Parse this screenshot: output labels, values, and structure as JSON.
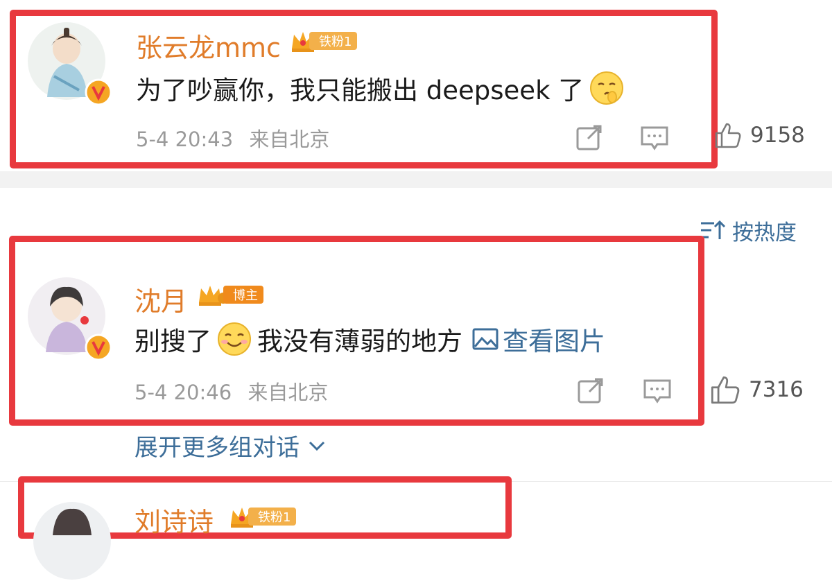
{
  "comments": [
    {
      "username": "张云龙mmc",
      "badge": "铁粉1",
      "text_before": "为了吵赢你，我只能搬出 deepseek 了",
      "text_after": "",
      "emoji": "shushing-face-emoji",
      "time": "5-4 20:43",
      "location": "来自北京",
      "likes": "9158"
    },
    {
      "username": "沈月",
      "badge": "博主",
      "text_before": "别搜了",
      "text_after": "我没有薄弱的地方",
      "emoji": "smiling-face-emoji",
      "link_label": "查看图片",
      "time": "5-4 20:46",
      "location": "来自北京",
      "likes": "7316"
    },
    {
      "username": "刘诗诗",
      "badge": "铁粉1"
    }
  ],
  "sort": {
    "label": "按热度"
  },
  "expand": {
    "label": "展开更多组对话"
  },
  "colors": {
    "highlight": "#e8393e",
    "username": "#e07c2a",
    "link": "#3d6e99",
    "badge": "#f5a623"
  }
}
